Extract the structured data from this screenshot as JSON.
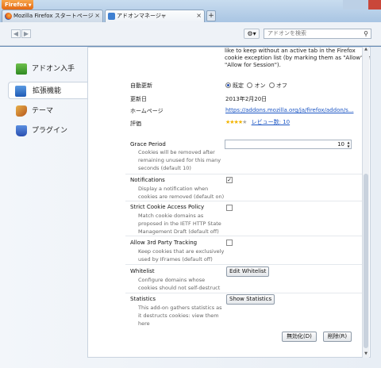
{
  "app": {
    "menu_label": "Firefox"
  },
  "tabs": [
    {
      "label": "Mozilla Firefox スタートページ"
    },
    {
      "label": "アドオンマネージャ"
    }
  ],
  "toolbar": {
    "back": "◀",
    "forward": "▶",
    "search_placeholder": "アドオンを検索"
  },
  "sidebar": {
    "items": [
      {
        "label": "アドオン入手",
        "icon": "download-icon"
      },
      {
        "label": "拡張機能",
        "icon": "puzzle-icon"
      },
      {
        "label": "テーマ",
        "icon": "brush-icon"
      },
      {
        "label": "プラグイン",
        "icon": "plugin-icon"
      }
    ]
  },
  "detail": {
    "top_text": "like to keep without an active tab in the Firefox cookie exception list (by marking them as \"Allow\" or \"Allow for Session\").",
    "auto_update_label": "自動更新",
    "auto_update_options": [
      "既定",
      "オン",
      "オフ"
    ],
    "updated_label": "更新日",
    "updated_value": "2013年2月20日",
    "homepage_label": "ホームページ",
    "homepage_value": "https://addons.mozilla.org/ja/firefox/addon/s...",
    "rating_label": "評価",
    "rating_stars": 4,
    "reviews": "レビュー数: 10"
  },
  "prefs": {
    "grace_name": "Grace Period",
    "grace_desc": "Cookies will be removed after remaining unused for this many seconds (default 10)",
    "grace_value": "10",
    "notif_name": "Notifications",
    "notif_desc": "Display a notification when cookies are removed (default on)",
    "notif_checked": "✓",
    "strict_name": "Strict Cookie Access Policy",
    "strict_desc": "Match cookie domains as proposed in the IETF HTTP State Management Draft (default off)",
    "thirdparty_name": "Allow 3rd Party Tracking",
    "thirdparty_desc": "Keep cookies that are exclusively used by IFrames (default off)",
    "whitelist_name": "Whitelist",
    "whitelist_desc": "Configure domains whose cookies should not self-destruct",
    "whitelist_button": "Edit Whitelist",
    "stats_name": "Statistics",
    "stats_desc": "This add-on gathers statistics as it destructs cookies: view them here",
    "stats_button": "Show Statistics"
  },
  "actions": {
    "disable": "無効化(D)",
    "remove": "削除(R)"
  }
}
